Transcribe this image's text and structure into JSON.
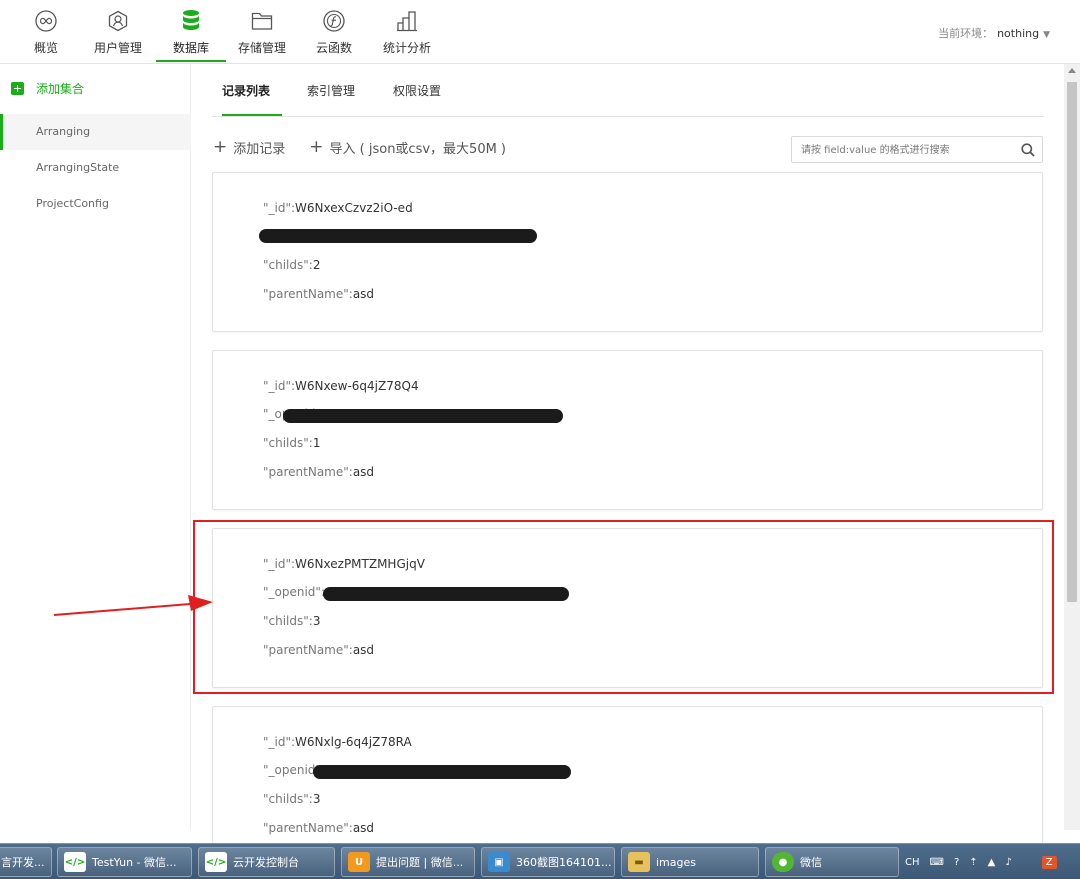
{
  "nav": {
    "items": [
      {
        "label": "概览",
        "icon": "infinity-circle-icon"
      },
      {
        "label": "用户管理",
        "icon": "user-shield-icon"
      },
      {
        "label": "数据库",
        "icon": "database-icon"
      },
      {
        "label": "存储管理",
        "icon": "folder-icon"
      },
      {
        "label": "云函数",
        "icon": "function-circle-icon"
      },
      {
        "label": "统计分析",
        "icon": "bar-stats-icon"
      }
    ],
    "active_index": 2,
    "env_label": "当前环境：",
    "env_value": "nothing"
  },
  "sidebar": {
    "add_label": "添加集合",
    "collections": [
      "Arranging",
      "ArrangingState",
      "ProjectConfig"
    ],
    "active_collection": "Arranging"
  },
  "tabs": {
    "items": [
      "记录列表",
      "索引管理",
      "权限设置"
    ],
    "active_index": 0
  },
  "toolbar": {
    "add_record_label": "添加记录",
    "import_label": "导入 ( json或csv，最大50M )"
  },
  "search": {
    "placeholder": "请按 field:value 的格式进行搜索"
  },
  "records": [
    {
      "id_key": "\"_id\":",
      "id": "W6NxexCzvz2iO-ed",
      "openid_key": "",
      "childs_key": "\"childs\":",
      "childs": "2",
      "parent_key": "\"parentName\":",
      "parentName": "asd"
    },
    {
      "id_key": "\"_id\":",
      "id": "W6Nxew-6q4jZ78Q4",
      "openid_key": "\"_openid\":",
      "childs_key": "\"childs\":",
      "childs": "1",
      "parent_key": "\"parentName\":",
      "parentName": "asd"
    },
    {
      "id_key": "\"_id\":",
      "id": "W6NxezPMTZMHGjqV",
      "openid_key": "\"_openid\":",
      "childs_key": "\"childs\":",
      "childs": "3",
      "parent_key": "\"parentName\":",
      "parentName": "asd"
    },
    {
      "id_key": "\"_id\":",
      "id": "W6Nxlg-6q4jZ78RA",
      "openid_key": "\"_openid\":",
      "childs_key": "\"childs\":",
      "childs": "3",
      "parent_key": "\"parentName\":",
      "parentName": "asd"
    }
  ],
  "annotation": {
    "highlight_color": "#e02020"
  },
  "taskbar": {
    "items": [
      {
        "label": "言开发...",
        "icon": "wechat-devtools-icon"
      },
      {
        "label": "TestYun - 微信...",
        "icon": "wechat-devtools-icon"
      },
      {
        "label": "云开发控制台",
        "icon": "wechat-devtools-icon"
      },
      {
        "label": "提出问题 | 微信...",
        "icon": "uc-browser-icon"
      },
      {
        "label": "360截图164101...",
        "icon": "screenshot-icon"
      },
      {
        "label": "images",
        "icon": "folder-icon"
      },
      {
        "label": "微信",
        "icon": "wechat-icon"
      }
    ],
    "tray_lang": "CH"
  },
  "colors": {
    "accent": "#1aad19",
    "text": "#333333",
    "border": "#e2e2e2"
  }
}
